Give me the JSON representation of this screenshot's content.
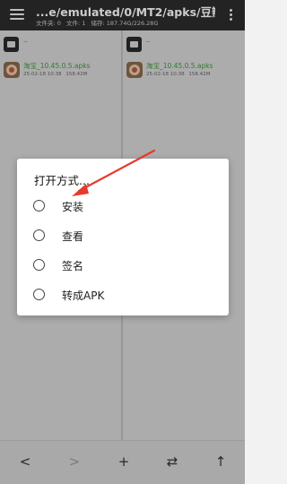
{
  "topbar": {
    "path": "...e/emulated/0/MT2/apks/豆瓣/",
    "info": [
      "文件夹: 0",
      "文件: 1",
      "储存: 187.74G/226.28G"
    ]
  },
  "panes": {
    "up_label": "..",
    "file": {
      "name": "淘宝_10.45.0.5.apks",
      "date": "25-02-18 10:38",
      "size": "158.42M"
    }
  },
  "dialog": {
    "title": "打开方式...",
    "options": [
      "安装",
      "查看",
      "签名",
      "转成APK"
    ]
  },
  "bottombar": {
    "back": "<",
    "forward": ">",
    "add": "+",
    "swap": "⇄",
    "up": "↑"
  },
  "annotation": {
    "arrow_color": "#e8392c"
  }
}
